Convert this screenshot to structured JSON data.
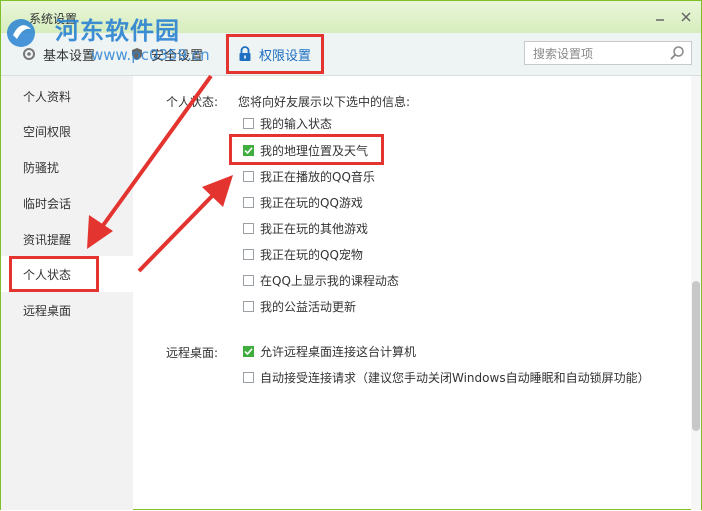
{
  "window": {
    "title": "系统设置"
  },
  "watermark": {
    "title": "河东软件园",
    "url": "www.pc0359.cn"
  },
  "toolbar": {
    "tabs": [
      {
        "label": "基本设置",
        "icon": "gear-icon"
      },
      {
        "label": "安全设置",
        "icon": "shield-icon"
      },
      {
        "label": "权限设置",
        "icon": "lock-icon"
      }
    ]
  },
  "search": {
    "placeholder": "搜索设置项"
  },
  "sidebar": {
    "items": [
      {
        "label": "个人资料"
      },
      {
        "label": "空间权限"
      },
      {
        "label": "防骚扰"
      },
      {
        "label": "临时会话"
      },
      {
        "label": "资讯提醒"
      },
      {
        "label": "个人状态"
      },
      {
        "label": "远程桌面"
      }
    ]
  },
  "status_section": {
    "label": "个人状态:",
    "description": "您将向好友展示以下选中的信息:",
    "options": [
      {
        "label": "我的输入状态",
        "checked": false
      },
      {
        "label": "我的地理位置及天气",
        "checked": true
      },
      {
        "label": "我正在播放的QQ音乐",
        "checked": false
      },
      {
        "label": "我正在玩的QQ游戏",
        "checked": false
      },
      {
        "label": "我正在玩的其他游戏",
        "checked": false
      },
      {
        "label": "我正在玩的QQ宠物",
        "checked": false
      },
      {
        "label": "在QQ上显示我的课程动态",
        "checked": false
      },
      {
        "label": "我的公益活动更新",
        "checked": false
      }
    ]
  },
  "remote_section": {
    "label": "远程桌面:",
    "options": [
      {
        "label": "允许远程桌面连接这台计算机",
        "checked": true
      },
      {
        "label": "自动接受连接请求（建议您手动关闭Windows自动睡眠和自动锁屏功能）",
        "checked": false
      }
    ]
  },
  "colors": {
    "accent": "#1e6fc1",
    "highlight": "#e3342f",
    "check": "#3fae3f"
  }
}
